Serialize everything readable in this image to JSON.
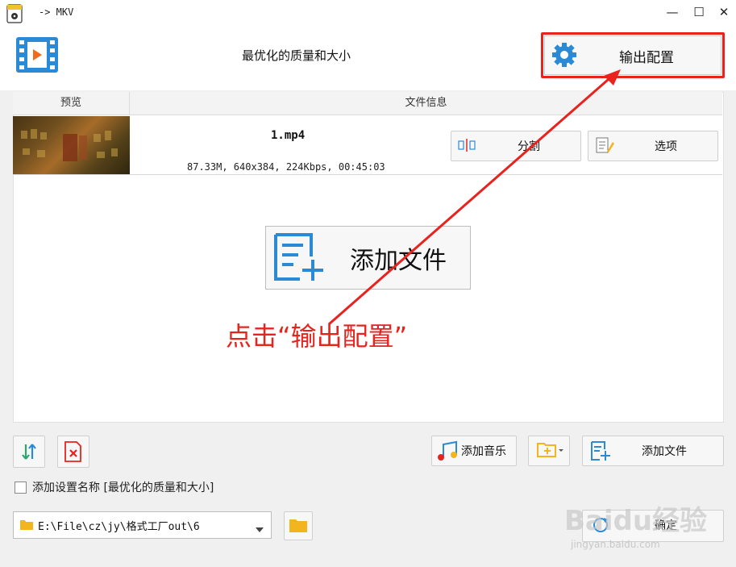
{
  "window": {
    "title": "-> MKV",
    "minimize": "—",
    "maximize": "☐",
    "close": "✕"
  },
  "header": {
    "profile": "最优化的质量和大小",
    "output_config": "输出配置"
  },
  "table": {
    "columns": [
      "预览",
      "文件信息"
    ],
    "rows": [
      {
        "filename": "1.mp4",
        "info": "87.33M, 640x384, 224Kbps, 00:45:03",
        "split_label": "分割",
        "options_label": "选项"
      }
    ]
  },
  "main": {
    "add_file_big": "添加文件"
  },
  "annotation": {
    "text": "点击“输出配置”",
    "color": "#e8231e"
  },
  "bottom": {
    "add_music": "添加音乐",
    "add_file": "添加文件",
    "add_setting_name": "添加设置名称 [最优化的质量和大小]",
    "output_path": "E:\\File\\cz\\jy\\格式工厂out\\6",
    "ok": "确定"
  },
  "watermark": {
    "text": "Baidu经验",
    "sub": "jingyan.baidu.com"
  },
  "colors": {
    "accent_blue": "#2a8ad6",
    "highlight_red": "#e8231e",
    "folder_yellow": "#f2b51e"
  }
}
